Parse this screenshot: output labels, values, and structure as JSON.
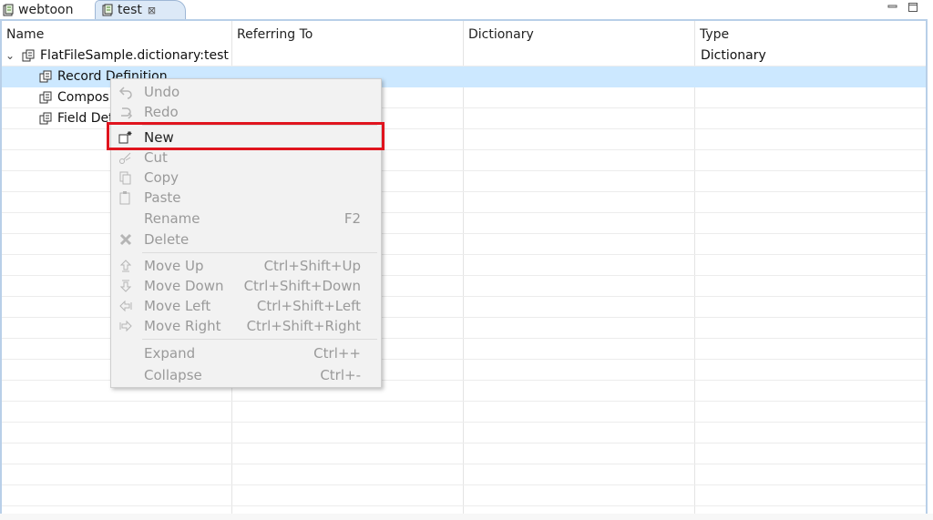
{
  "tabs": [
    {
      "label": "webtoon"
    },
    {
      "label": "test",
      "close": "⊠"
    }
  ],
  "table": {
    "headers": [
      "Name",
      "Referring To",
      "Dictionary",
      "Type"
    ],
    "rows": [
      {
        "name": "FlatFileSample.dictionary:test",
        "type": "Dictionary",
        "expanded": true
      },
      {
        "name": "Record Definition",
        "selected": true
      },
      {
        "name": "Composi"
      },
      {
        "name": "Field Det"
      }
    ]
  },
  "menu": {
    "items": [
      {
        "label": "Undo",
        "shortcut": ""
      },
      {
        "label": "Redo",
        "shortcut": ""
      },
      {
        "label": "New",
        "shortcut": ""
      },
      {
        "label": "Cut",
        "shortcut": ""
      },
      {
        "label": "Copy",
        "shortcut": ""
      },
      {
        "label": "Paste",
        "shortcut": ""
      },
      {
        "label": "Rename",
        "shortcut": "F2"
      },
      {
        "label": "Delete",
        "shortcut": ""
      },
      {
        "label": "Move Up",
        "shortcut": "Ctrl+Shift+Up"
      },
      {
        "label": "Move Down",
        "shortcut": "Ctrl+Shift+Down"
      },
      {
        "label": "Move Left",
        "shortcut": "Ctrl+Shift+Left"
      },
      {
        "label": "Move Right",
        "shortcut": "Ctrl+Shift+Right"
      },
      {
        "label": "Expand",
        "shortcut": "Ctrl++"
      },
      {
        "label": "Collapse",
        "shortcut": "Ctrl+-"
      }
    ]
  },
  "colors": {
    "selection": "#cce8ff",
    "highlight_box": "#e0141e",
    "panel_border": "#b8cfe8"
  }
}
